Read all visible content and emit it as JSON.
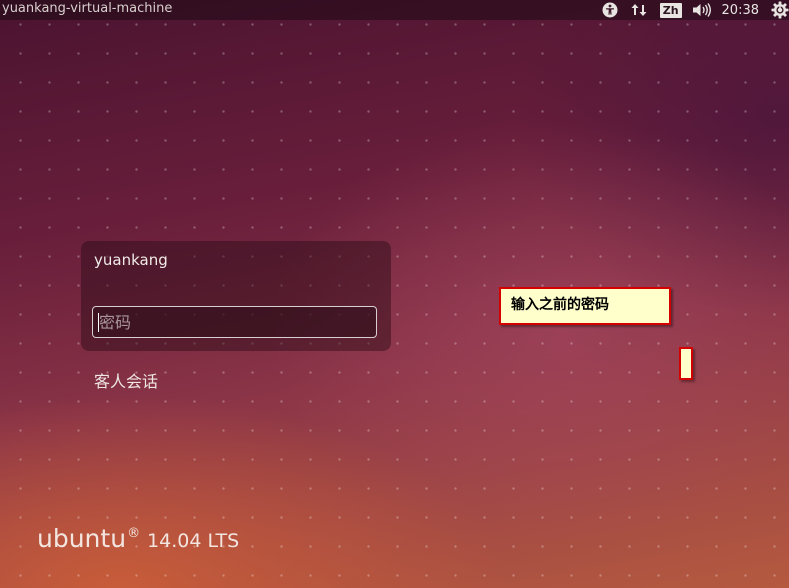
{
  "topbar": {
    "hostname": "yuankang-virtual-machine",
    "keyboard_layout": "Zh",
    "clock": "20:38",
    "icons": {
      "accessibility": "accessibility-icon",
      "network": "network-updown-icon",
      "sound": "speaker-volume-icon",
      "session": "gear-power-icon"
    }
  },
  "login": {
    "username": "yuankang",
    "password_placeholder": "密码",
    "password_value": "",
    "guest_session": "客人会话"
  },
  "annotation": {
    "callout_text": "输入之前的密码",
    "border_color": "#d40000",
    "fill_color": "#ffffcc"
  },
  "branding": {
    "wordmark": "ubuntu",
    "registered_mark": "®",
    "version": "14.04 LTS"
  },
  "colors": {
    "background_top": "#4a1330",
    "background_bottom": "#b55a3f",
    "text_light": "#f1ecea"
  }
}
